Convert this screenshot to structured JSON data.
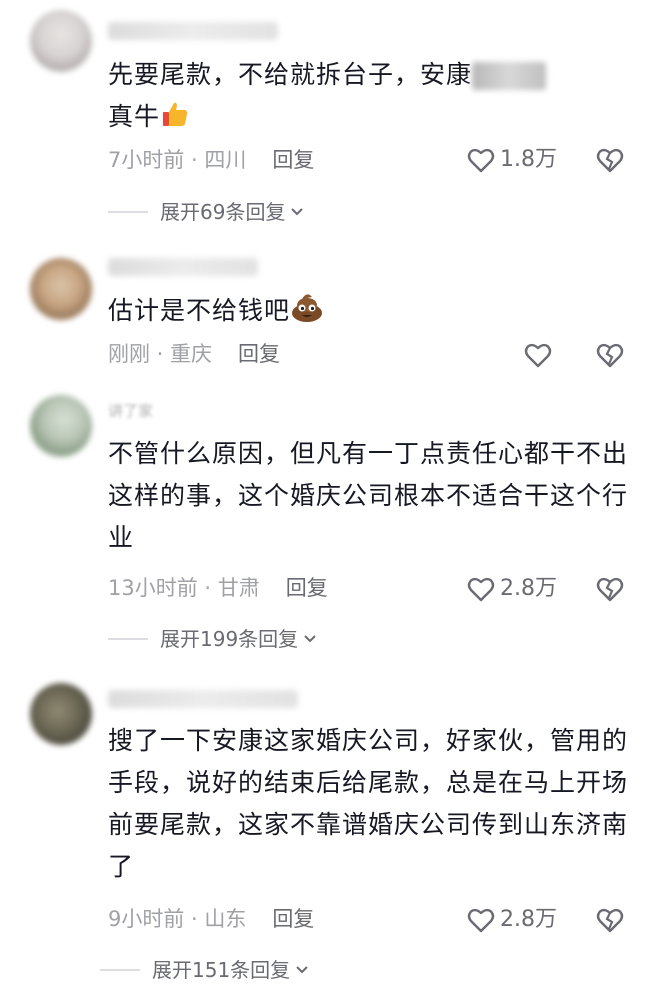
{
  "comments": [
    {
      "username": "",
      "text_a": "先要尾款，不给就拆台子，安康",
      "text_b": "真牛",
      "emoji": "thumbs-up",
      "time_loc": "7小时前 · 四川",
      "reply": "回复",
      "likes": "1.8万",
      "expand": "展开69条回复"
    },
    {
      "username": "",
      "text": "估计是不给钱吧",
      "emoji": "poop-face",
      "time_loc": "刚刚 · 重庆",
      "reply": "回复"
    },
    {
      "username": "讲了家",
      "text": "不管什么原因，但凡有一丁点责任心都干不出这样的事，这个婚庆公司根本不适合干这个行业",
      "time_loc": "13小时前 · 甘肃",
      "reply": "回复",
      "likes": "2.8万",
      "expand": "展开199条回复"
    },
    {
      "username": "",
      "text": "搜了一下安康这家婚庆公司，好家伙，管用的手段，说好的结束后给尾款，总是在马上开场前要尾款，这家不靠谱婚庆公司传到山东济南了",
      "time_loc": "9小时前 · 山东",
      "reply": "回复",
      "likes": "2.8万",
      "expand": "展开151条回复"
    }
  ],
  "colors": {
    "text": "#161823",
    "meta": "#a0a1a6",
    "action": "#6a6b72"
  }
}
